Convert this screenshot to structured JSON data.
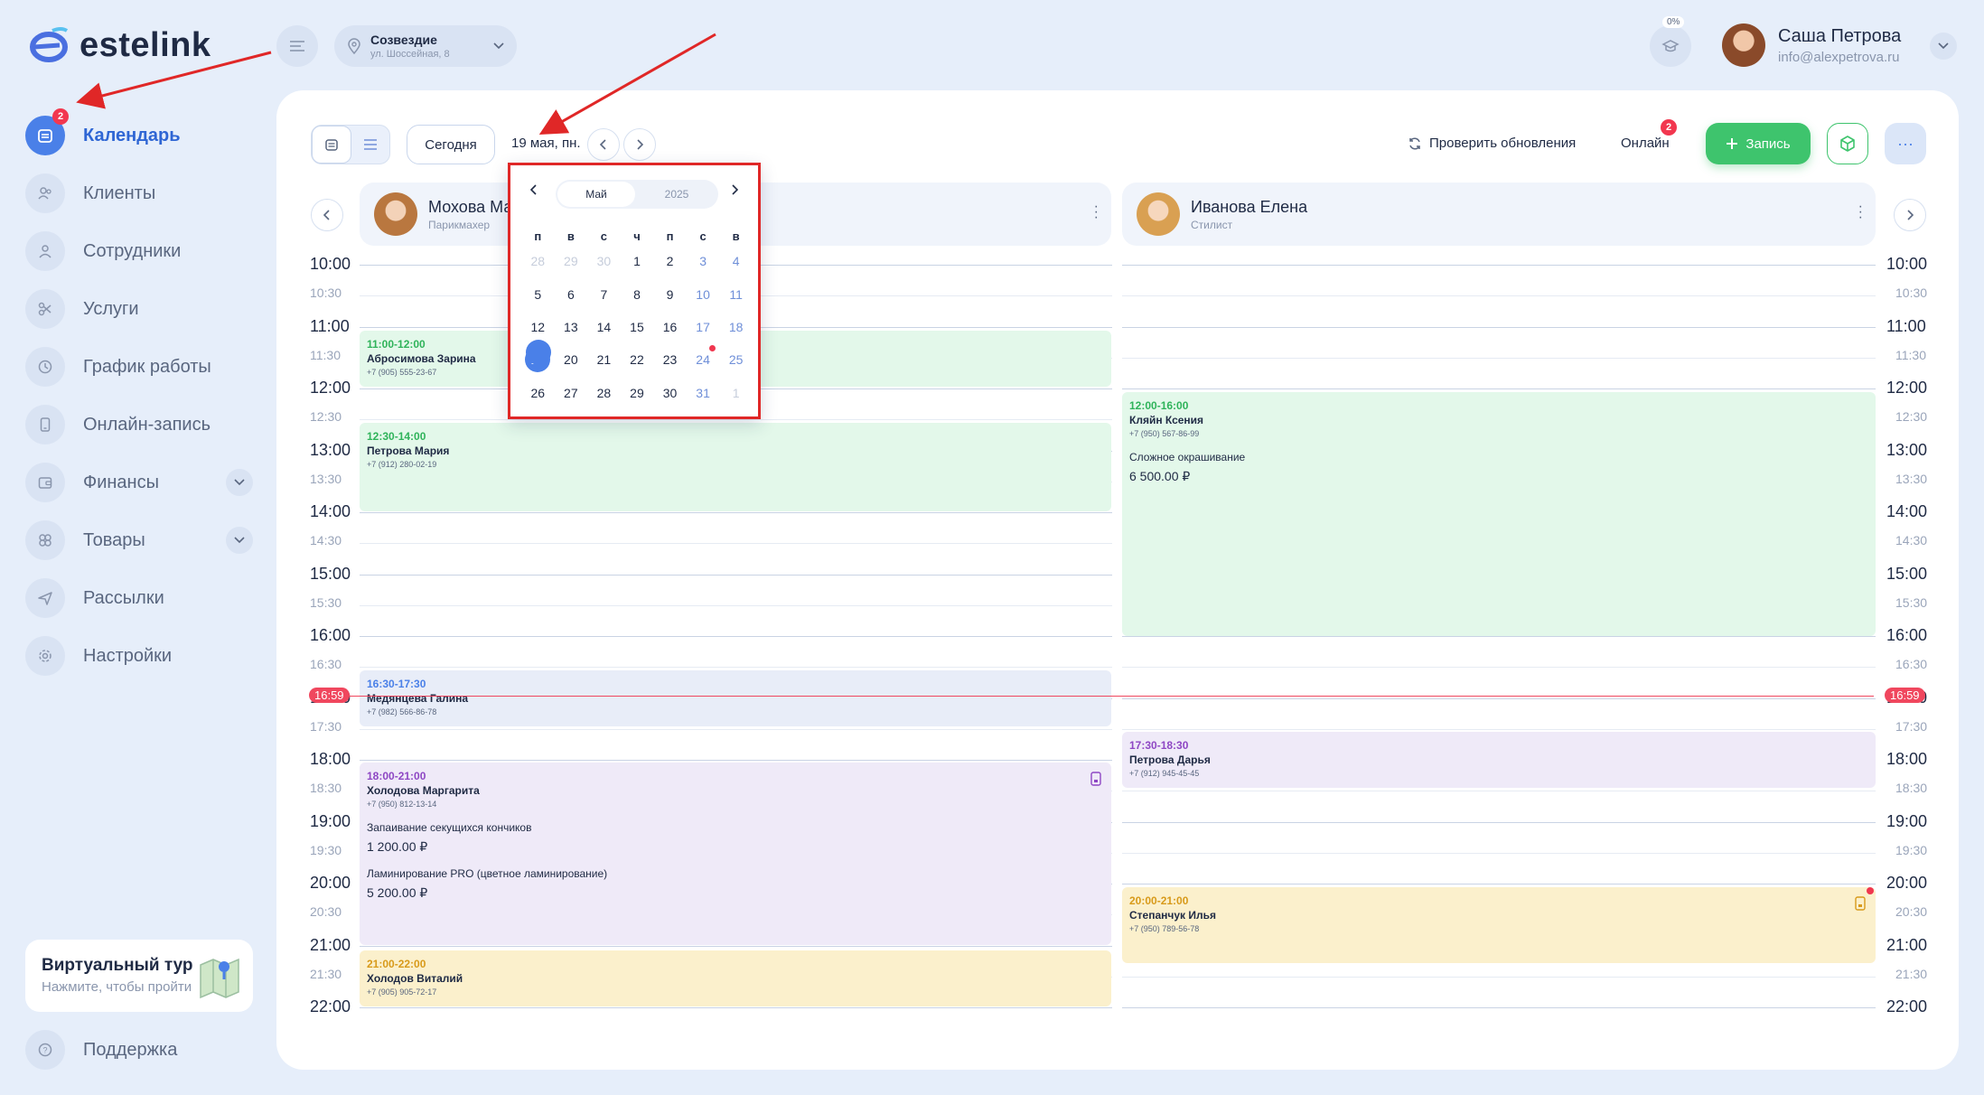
{
  "app": {
    "logo_text": "estelink"
  },
  "sidebar": {
    "items": [
      {
        "key": "calendar",
        "label": "Календарь",
        "active": true,
        "badge": "2"
      },
      {
        "key": "clients",
        "label": "Клиенты"
      },
      {
        "key": "staff",
        "label": "Сотрудники"
      },
      {
        "key": "services",
        "label": "Услуги"
      },
      {
        "key": "schedule",
        "label": "График работы"
      },
      {
        "key": "online",
        "label": "Онлайн-запись"
      },
      {
        "key": "finance",
        "label": "Финансы",
        "expandable": true
      },
      {
        "key": "goods",
        "label": "Товары",
        "expandable": true
      },
      {
        "key": "mailing",
        "label": "Рассылки"
      },
      {
        "key": "settings",
        "label": "Настройки"
      }
    ],
    "tour": {
      "title": "Виртуальный тур",
      "subtitle": "Нажмите, чтобы пройти"
    },
    "support": "Поддержка"
  },
  "header": {
    "branch": {
      "name": "Созвездие",
      "address": "ул. Шоссейная, 8"
    },
    "progress": "0%",
    "user": {
      "name": "Саша Петрова",
      "email": "info@alexpetrova.ru"
    }
  },
  "toolbar": {
    "today": "Сегодня",
    "date": "19 мая, пн.",
    "check_updates": "Проверить обновления",
    "online": "Онлайн",
    "online_badge": "2",
    "add": "Запись",
    "more": "···"
  },
  "staff": [
    {
      "name": "Мохова Ма",
      "role": "Парикмахер"
    },
    {
      "name": "Иванова Елена",
      "role": "Стилист"
    }
  ],
  "times": [
    "10:00",
    "10:30",
    "11:00",
    "11:30",
    "12:00",
    "12:30",
    "13:00",
    "13:30",
    "14:00",
    "14:30",
    "15:00",
    "15:30",
    "16:00",
    "16:30",
    "17:00",
    "17:30",
    "18:00",
    "18:30",
    "19:00",
    "19:30",
    "20:00",
    "20:30",
    "21:00",
    "21:30",
    "22:00"
  ],
  "now": "16:59",
  "appointments": {
    "a1": {
      "time": "11:00-12:00",
      "name": "Абросимова Зарина",
      "phone": "+7 (905) 555-23-67"
    },
    "a2": {
      "time": "12:30-14:00",
      "name": "Петрова Мария",
      "phone": "+7 (912) 280-02-19"
    },
    "a3": {
      "time": "16:30-17:30",
      "name": "Медянцева Галина",
      "phone": "+7 (982) 566-86-78"
    },
    "a4": {
      "time": "18:00-21:00",
      "name": "Холодова Маргарита",
      "phone": "+7 (950) 812-13-14",
      "service1": "Запаивание секущихся кончиков",
      "price1": "1 200.00 ₽",
      "service2": "Ламинирование PRO (цветное ламинирование)",
      "price2": "5 200.00 ₽"
    },
    "a5": {
      "time": "21:00-22:00",
      "name": "Холодов Виталий",
      "phone": "+7 (905) 905-72-17"
    },
    "b1": {
      "time": "12:00-16:00",
      "name": "Кляйн Ксения",
      "phone": "+7 (950) 567-86-99",
      "service": "Сложное окрашивание",
      "price": "6 500.00 ₽"
    },
    "b2": {
      "time": "17:30-18:30",
      "name": "Петрова Дарья",
      "phone": "+7 (912) 945-45-45"
    },
    "b3": {
      "time": "20:00-21:00",
      "name": "Степанчук Илья",
      "phone": "+7 (950) 789-56-78"
    }
  },
  "picker": {
    "month": "Май",
    "year": "2025",
    "dow": [
      "п",
      "в",
      "с",
      "ч",
      "п",
      "с",
      "в"
    ],
    "weeks": [
      [
        "28",
        "29",
        "30",
        "1",
        "2",
        "3",
        "4"
      ],
      [
        "5",
        "6",
        "7",
        "8",
        "9",
        "10",
        "11"
      ],
      [
        "12",
        "13",
        "14",
        "15",
        "16",
        "17",
        "18"
      ],
      [
        "19",
        "20",
        "21",
        "22",
        "23",
        "24",
        "25"
      ],
      [
        "26",
        "27",
        "28",
        "29",
        "30",
        "31",
        "1"
      ]
    ],
    "selected": "19"
  },
  "colors": {
    "accent": "#4a80e8",
    "green": "#3ec46d",
    "red": "#f0475e"
  }
}
